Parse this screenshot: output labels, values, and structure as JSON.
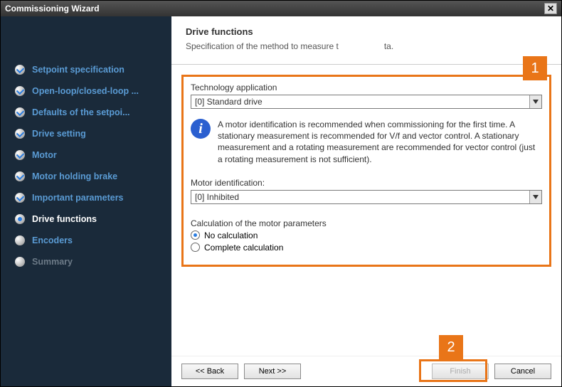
{
  "window": {
    "title": "Commissioning Wizard"
  },
  "sidebar": {
    "items": [
      {
        "label": "Setpoint specification",
        "state": "checked"
      },
      {
        "label": "Open-loop/closed-loop ...",
        "state": "checked"
      },
      {
        "label": "Defaults of the setpoi...",
        "state": "checked"
      },
      {
        "label": "Drive setting",
        "state": "checked"
      },
      {
        "label": "Motor",
        "state": "checked"
      },
      {
        "label": "Motor holding brake",
        "state": "checked"
      },
      {
        "label": "Important parameters",
        "state": "checked"
      },
      {
        "label": "Drive functions",
        "state": "current"
      },
      {
        "label": "Encoders",
        "state": "pending"
      },
      {
        "label": "Summary",
        "state": "disabled"
      }
    ]
  },
  "header": {
    "title": "Drive functions",
    "subtitle_left": "Specification of the method to measure t",
    "subtitle_right": "ta."
  },
  "content": {
    "tech_app_label": "Technology application",
    "tech_app_value": "[0] Standard drive",
    "info_text": "A motor identification is recommended when commissioning for the first time. A stationary measurement is recommended for V/f and vector control. A stationary measurement and a rotating measurement are recommended for vector control (just a rotating measurement is not sufficient).",
    "motor_id_label": "Motor identification:",
    "motor_id_value": "[0] Inhibited",
    "calc_label": "Calculation of the motor parameters",
    "radios": [
      {
        "label": "No calculation",
        "selected": true
      },
      {
        "label": "Complete calculation",
        "selected": false
      }
    ]
  },
  "buttons": {
    "back": "<< Back",
    "next": "Next >>",
    "finish": "Finish",
    "cancel": "Cancel"
  },
  "callouts": {
    "one": "1",
    "two": "2"
  }
}
